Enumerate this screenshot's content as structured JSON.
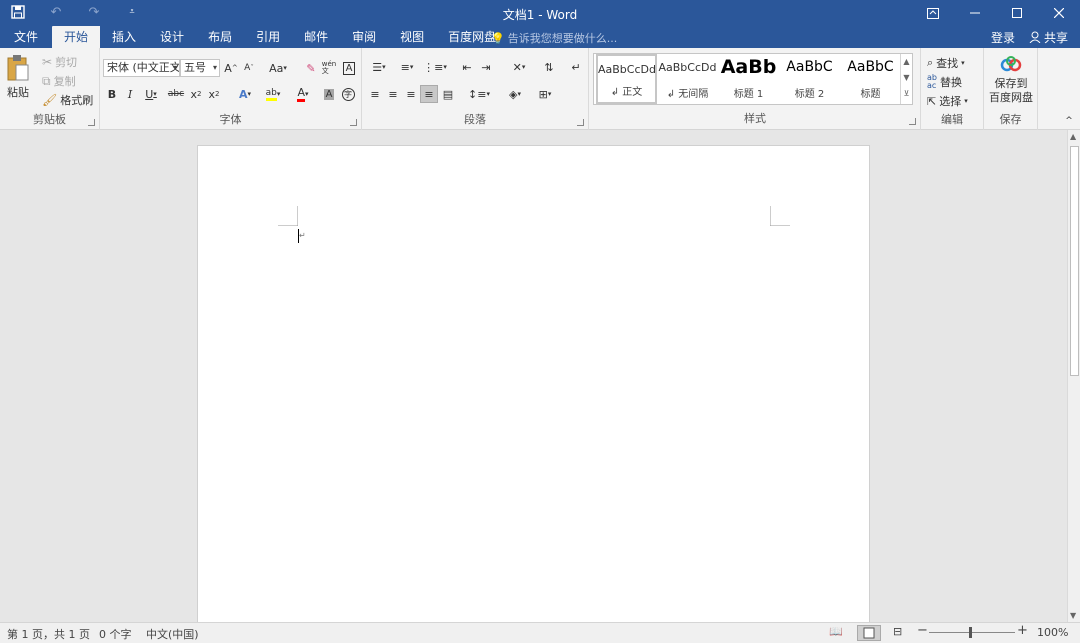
{
  "app": {
    "title": "文档1 - Word"
  },
  "quick_access": {
    "save": "save-icon",
    "undo": "undo-icon",
    "redo": "redo-icon",
    "customize": "customize-icon"
  },
  "tabs": [
    {
      "label": "文件"
    },
    {
      "label": "开始"
    },
    {
      "label": "插入"
    },
    {
      "label": "设计"
    },
    {
      "label": "布局"
    },
    {
      "label": "引用"
    },
    {
      "label": "邮件"
    },
    {
      "label": "审阅"
    },
    {
      "label": "视图"
    },
    {
      "label": "百度网盘"
    }
  ],
  "tell_me": {
    "placeholder": "告诉我您想要做什么..."
  },
  "account": {
    "login": "登录",
    "share": "共享"
  },
  "clipboard": {
    "paste": "粘贴",
    "cut": "剪切",
    "copy": "复制",
    "format_painter": "格式刷",
    "label": "剪贴板"
  },
  "font": {
    "family": "宋体 (中文正文)",
    "size": "五号",
    "label": "字体",
    "case": "Aa"
  },
  "paragraph": {
    "label": "段落"
  },
  "styles": {
    "label": "样式",
    "items": [
      {
        "preview": "AaBbCcDd",
        "name": "↲ 正文"
      },
      {
        "preview": "AaBbCcDd",
        "name": "↲ 无间隔"
      },
      {
        "preview": "AaBb",
        "name": "标题 1"
      },
      {
        "preview": "AaBbC",
        "name": "标题 2"
      },
      {
        "preview": "AaBbC",
        "name": "标题"
      }
    ]
  },
  "editing": {
    "find": "查找",
    "replace": "替换",
    "select": "选择",
    "label": "编辑"
  },
  "save_group": {
    "button": "保存到\n百度网盘",
    "button_l1": "保存到",
    "button_l2": "百度网盘",
    "label": "保存"
  },
  "status_bar": {
    "page": "第 1 页，共 1 页",
    "words": "0 个字",
    "language": "中文(中国)",
    "zoom": "100%"
  },
  "colors": {
    "accent": "#2b579a",
    "highlight": "#ffff00",
    "font_color": "#ff0000"
  }
}
